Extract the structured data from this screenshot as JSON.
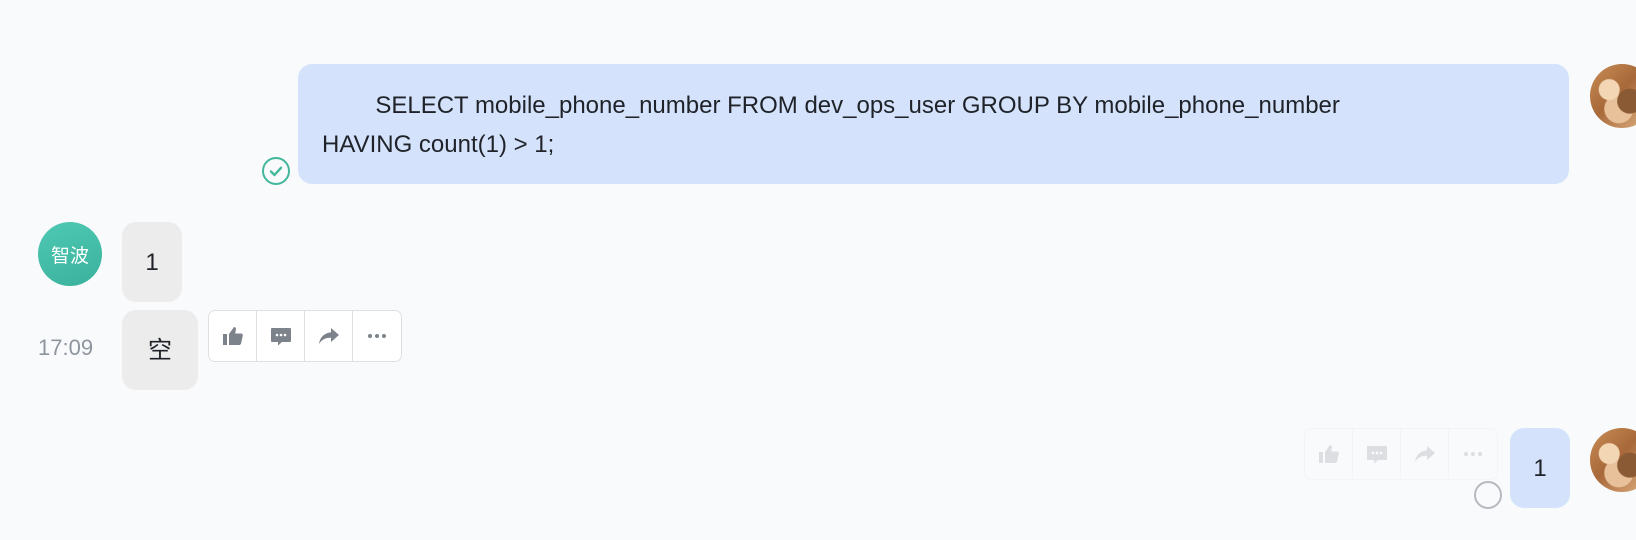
{
  "messages": {
    "sql_message": {
      "text": "        SELECT mobile_phone_number FROM dev_ops_user GROUP BY mobile_phone_number\nHAVING count(1) > 1;"
    },
    "reply_one": {
      "text": "1"
    },
    "reply_empty": {
      "text": "空"
    },
    "self_one": {
      "text": "1"
    }
  },
  "contact": {
    "avatar_label": "智波"
  },
  "timestamp": "17:09",
  "toolbar_icons": [
    "thumbs-up-icon",
    "comment-icon",
    "forward-icon",
    "more-icon"
  ],
  "colors": {
    "self_bubble": "#d4e3fb",
    "other_bubble": "#ececed",
    "read_check": "#43b89c",
    "avatar_teal": "#3ab19c"
  }
}
